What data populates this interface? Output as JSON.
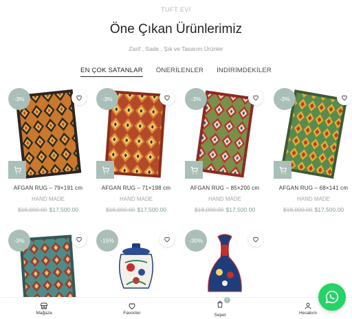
{
  "header": {
    "brand": "TUFT EVİ",
    "title": "Öne Çıkan Ürünlerimiz",
    "subtitle": "Zarif , Sade , Şık ve Tasarım Ürünler"
  },
  "tabs": [
    {
      "label": "EN ÇOK SATANLAR",
      "active": true
    },
    {
      "label": "ÖNERİLENLER",
      "active": false
    },
    {
      "label": "İNDİRİMDEKİLER",
      "active": false
    }
  ],
  "products": [
    {
      "discount": "-3%",
      "name": "AFGAN RUG – 79×191 cm",
      "category": "HAND MADE",
      "old_price": "$18,000.00",
      "new_price": "$17,500.00",
      "image": "rug-orange-black"
    },
    {
      "discount": "-3%",
      "name": "AFGAN RUG – 71×198 cm",
      "category": "HAND MADE",
      "old_price": "$18,000.00",
      "new_price": "$17,500.00",
      "image": "rug-red-orange"
    },
    {
      "discount": "-3%",
      "name": "AFGAN RUG – 85×200 cm",
      "category": "HAND MADE",
      "old_price": "$18,000.00",
      "new_price": "$17,500.00",
      "image": "rug-green-red"
    },
    {
      "discount": "-3%",
      "name": "AFGAN RUG – 68×141 cm",
      "category": "HAND MADE",
      "old_price": "$18,000.00",
      "new_price": "$17,500.00",
      "image": "rug-green-yellow"
    },
    {
      "discount": "-3%",
      "name": "",
      "image": "rug-teal"
    },
    {
      "discount": "-15%",
      "name": "",
      "image": "ceramic-jar"
    },
    {
      "discount": "-30%",
      "name": "",
      "image": "ceramic-vase"
    }
  ],
  "bottom_nav": [
    {
      "label": "Mağaza",
      "icon": "store-icon"
    },
    {
      "label": "Favoriler",
      "icon": "heart-icon"
    },
    {
      "label": "Sepet",
      "icon": "cart-icon",
      "count": "0"
    },
    {
      "label": "Hesabım",
      "icon": "user-icon"
    }
  ],
  "colors": {
    "accent": "#a9bfb7",
    "price": "#7e9d92",
    "whatsapp": "#25d366"
  }
}
